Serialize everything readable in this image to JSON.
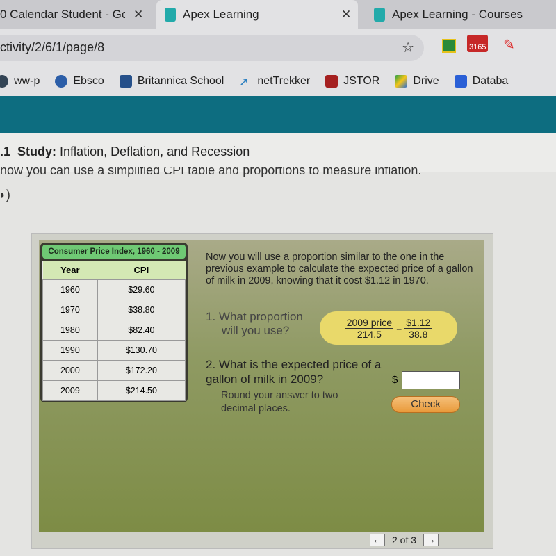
{
  "browser": {
    "tabs": [
      {
        "title": "0 Calendar Student - Go"
      },
      {
        "title": "Apex Learning",
        "active": true
      },
      {
        "title": "Apex Learning - Courses"
      }
    ],
    "url": "ctivity/2/6/1/page/8",
    "gmail_badge": "3165",
    "bookmarks": [
      {
        "label": "ww-p"
      },
      {
        "label": "Ebsco"
      },
      {
        "label": "Britannica School"
      },
      {
        "label": "netTrekker"
      },
      {
        "label": "JSTOR"
      },
      {
        "label": "Drive"
      },
      {
        "label": "Databa"
      }
    ]
  },
  "study": {
    "number": ".1",
    "label": "Study:",
    "title": "Inflation, Deflation, and Recession",
    "clipped_line": "how you can use a simplified CPI table and proportions to measure inflation."
  },
  "cpi_table": {
    "title": "Consumer Price Index, 1960 - 2009",
    "headers": [
      "Year",
      "CPI"
    ],
    "rows": [
      [
        "1960",
        "$29.60"
      ],
      [
        "1970",
        "$38.80"
      ],
      [
        "1980",
        "$82.40"
      ],
      [
        "1990",
        "$130.70"
      ],
      [
        "2000",
        "$172.20"
      ],
      [
        "2009",
        "$214.50"
      ]
    ]
  },
  "question": {
    "intro": "Now you will use a proportion similar to the one in the previous example to calculate the expected price of a gallon of milk in 2009, knowing that it cost $1.12 in 1970.",
    "q1": "1.  What proportion",
    "q1b": "will you use?",
    "proportion": {
      "left_num": "2009 price",
      "left_den": "214.5",
      "eq": "=",
      "right_num": "$1.12",
      "right_den": "38.8"
    },
    "q2": "2. What is the expected price of a gallon of milk in 2009?",
    "round": "Round your answer to two decimal places.",
    "currency": "$",
    "answer_value": "",
    "check_label": "Check"
  },
  "pager": {
    "text": "2 of 3",
    "prev": "←",
    "next": "→"
  },
  "colors": {
    "header_teal": "#0d6d80",
    "table_title_green": "#6fc974",
    "proportion_yellow": "#e9d96a",
    "check_orange": "#e99a3a"
  }
}
